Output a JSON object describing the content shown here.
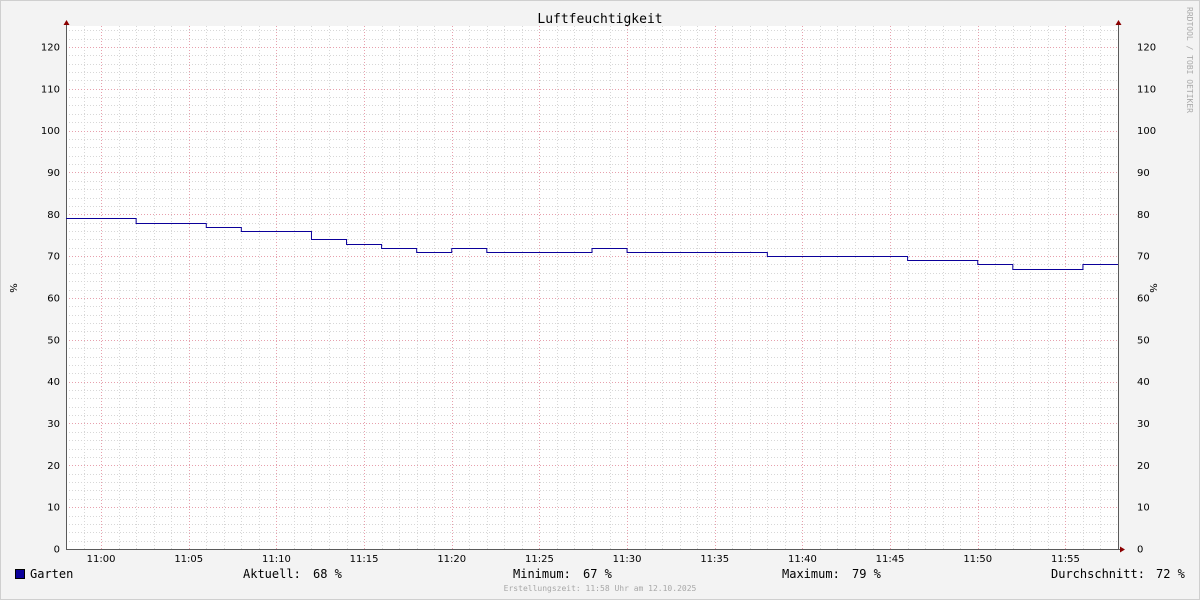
{
  "chart_data": {
    "type": "line",
    "title": "Luftfeuchtigkeit",
    "ylabel": "%",
    "ylabel_right": "%",
    "ylim": [
      0,
      125
    ],
    "yticks": [
      0,
      10,
      20,
      30,
      40,
      50,
      60,
      70,
      80,
      90,
      100,
      110,
      120
    ],
    "xlim": [
      "10:58",
      "11:58"
    ],
    "xticks": [
      "11:00",
      "11:05",
      "11:10",
      "11:15",
      "11:20",
      "11:25",
      "11:30",
      "11:35",
      "11:40",
      "11:45",
      "11:50",
      "11:55"
    ],
    "grid": true,
    "step": true,
    "series": [
      {
        "name": "Garten",
        "color": "#0b009a",
        "x": [
          "10:58",
          "11:02",
          "11:06",
          "11:08",
          "11:12",
          "11:14",
          "11:16",
          "11:18",
          "11:20",
          "11:22",
          "11:28",
          "11:30",
          "11:38",
          "11:46",
          "11:50",
          "11:52",
          "11:56",
          "11:58"
        ],
        "values": [
          79,
          78,
          77,
          76,
          74,
          73,
          72,
          71,
          72,
          71,
          72,
          71,
          70,
          69,
          68,
          67,
          68,
          68
        ]
      }
    ]
  },
  "legend": {
    "series_name": "Garten",
    "current_label": "Aktuell:",
    "current_value": "68 %",
    "min_label": "Minimum:",
    "min_value": "67 %",
    "max_label": "Maximum:",
    "max_value": "79 %",
    "avg_label": "Durchschnitt:",
    "avg_value": "72 %"
  },
  "watermark": "RRDTOOL / TOBI OETIKER",
  "footer": "Erstellungszeit: 11:58 Uhr am 12.10.2025",
  "colors": {
    "background": "#f3f3f3",
    "canvas": "#ffffff",
    "major_grid": "#e7a0ad",
    "minor_grid": "#d7d7d7",
    "axis": "#5a5a5a",
    "arrow": "#8b0000",
    "series": "#0b009a"
  }
}
